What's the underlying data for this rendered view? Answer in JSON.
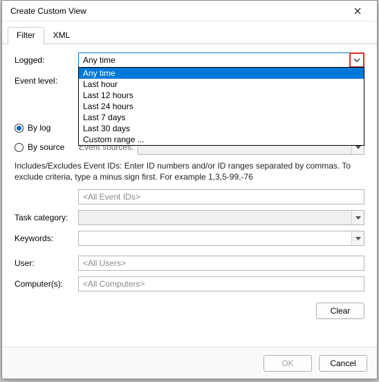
{
  "window": {
    "title": "Create Custom View"
  },
  "tabs": {
    "filter": "Filter",
    "xml": "XML"
  },
  "form": {
    "logged_label": "Logged:",
    "logged_value": "Any time",
    "logged_options": {
      "0": "Any time",
      "1": "Last hour",
      "2": "Last 12 hours",
      "3": "Last 24 hours",
      "4": "Last 7 days",
      "5": "Last 30 days",
      "6": "Custom range ..."
    },
    "eventlevel_label": "Event level:",
    "bylog_label": "By log",
    "bysource_label": "By source",
    "eventsources_label": "Event sources:",
    "help_text": "Includes/Excludes Event IDs: Enter ID numbers and/or ID ranges separated by commas. To exclude criteria, type a minus sign first. For example 1,3,5-99,-76",
    "eventids_placeholder": "<All Event IDs>",
    "taskcategory_label": "Task category:",
    "keywords_label": "Keywords:",
    "user_label": "User:",
    "user_placeholder": "<All Users>",
    "computers_label": "Computer(s):",
    "computers_placeholder": "<All Computers>",
    "clear": "Clear"
  },
  "footer": {
    "ok": "OK",
    "cancel": "Cancel"
  }
}
